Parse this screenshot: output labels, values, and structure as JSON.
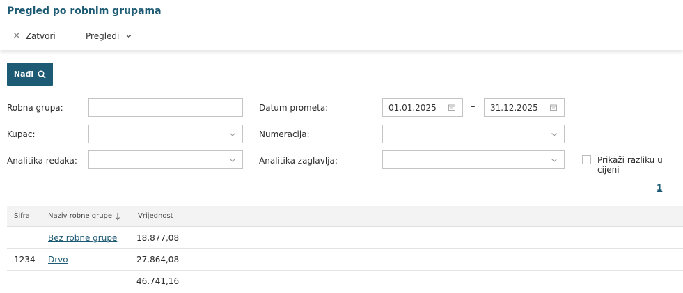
{
  "page": {
    "title": "Pregled po robnim grupama"
  },
  "toolbar": {
    "close_label": "Zatvori",
    "views_label": "Pregledi"
  },
  "search": {
    "button_label": "Nađi"
  },
  "filters": {
    "robna_grupa": {
      "label": "Robna grupa:",
      "value": ""
    },
    "datum_prometa": {
      "label": "Datum prometa:",
      "from": "01.01.2025",
      "separator": "–",
      "to": "31.12.2025"
    },
    "kupac": {
      "label": "Kupac:",
      "value": ""
    },
    "numeracija": {
      "label": "Numeracija:",
      "value": ""
    },
    "analitika_redaka": {
      "label": "Analitika redaka:",
      "value": ""
    },
    "analitika_zaglavlja": {
      "label": "Analitika zaglavlja:",
      "value": ""
    },
    "prikazi_razliku": {
      "label": "Prikaži razliku u cijeni",
      "checked": false
    }
  },
  "pagination": {
    "current_page": "1"
  },
  "table": {
    "columns": [
      "Šifra",
      "Naziv robne grupe",
      "Vrijednost"
    ],
    "sort": {
      "column": "Naziv robne grupe",
      "direction": "descending"
    },
    "rows": [
      {
        "sifra": "",
        "naziv": "Bez robne grupe",
        "vrijednost": "18.877,08"
      },
      {
        "sifra": "1234",
        "naziv": "Drvo",
        "vrijednost": "27.864,08"
      }
    ],
    "total": "46.741,16"
  },
  "colors": {
    "accent": "#1d5a73",
    "button": "#1c5b73",
    "header_bg": "#f3f3f3"
  }
}
